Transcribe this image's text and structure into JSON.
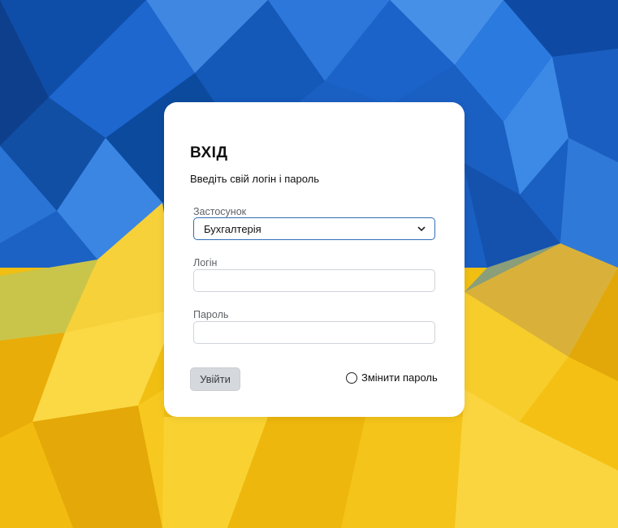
{
  "login_form": {
    "title": "ВХІД",
    "subtitle": "Введіть свій логін і пароль",
    "application": {
      "label": "Застосунок",
      "value": "Бухгалтерія"
    },
    "login": {
      "label": "Логін",
      "value": ""
    },
    "password": {
      "label": "Пароль",
      "value": ""
    },
    "submit_label": "Увійти",
    "change_password_label": "Змінити пароль"
  },
  "colors": {
    "accent": "#2f6db5",
    "blue": "#1e63c9",
    "yellow": "#f3c516",
    "button_bg": "#d5d8dd"
  },
  "icons": {
    "select_chevron": "chevron-down-icon"
  }
}
